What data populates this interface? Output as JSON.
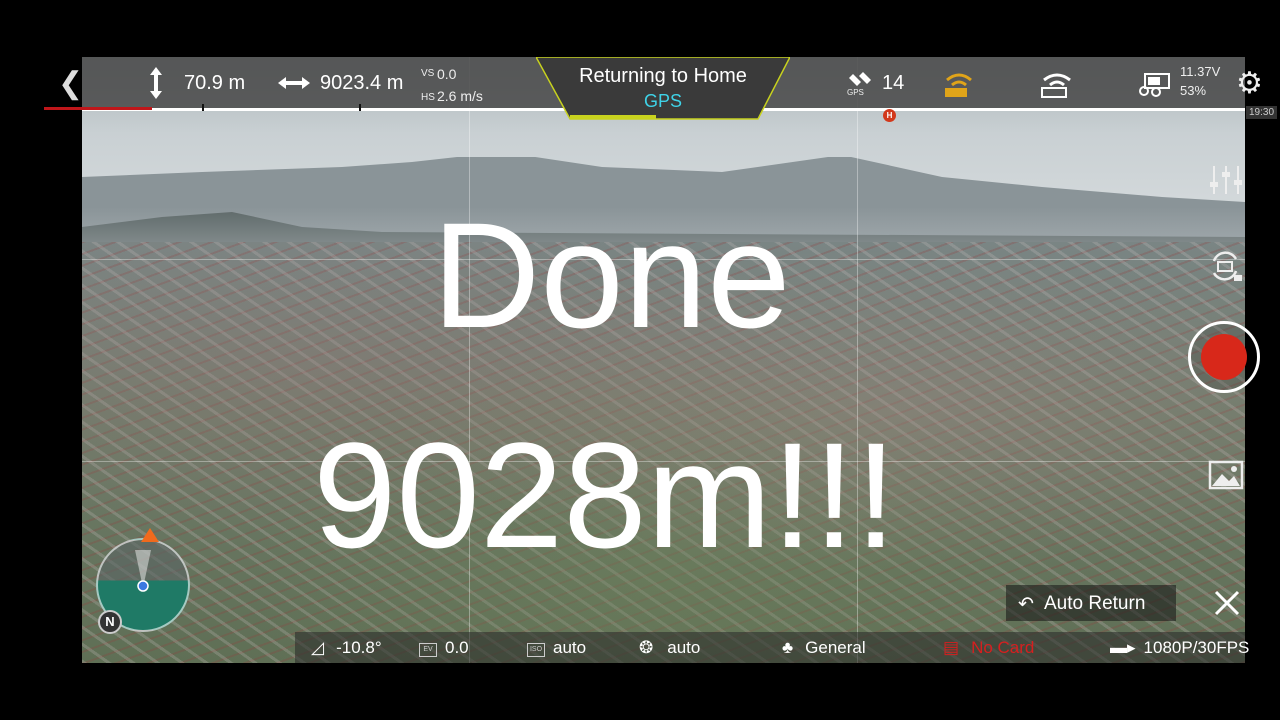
{
  "top_bar": {
    "altitude": "70.9 m",
    "distance": "9023.4 m",
    "vs_label": "VS",
    "vs_value": "0.0",
    "hs_label": "HS",
    "hs_value": "2.6 m/s",
    "status_title": "Returning to Home",
    "status_mode": "GPS",
    "gps_label": "GPS",
    "satellites": "14",
    "battery_voltage": "11.37V",
    "battery_percent": "53%",
    "home_marker": "H",
    "clock": "19:30"
  },
  "overlay": {
    "line1": "Done",
    "line2": "9028m!!!"
  },
  "right_controls": {
    "icons": [
      "sliders-icon",
      "camera-switch-icon",
      "record-button",
      "gallery-icon"
    ]
  },
  "compass": {
    "north_label": "N"
  },
  "auto_return": {
    "label": "Auto Return"
  },
  "bottom_bar": {
    "gimbal_pitch": "-10.8°",
    "ev_label": "EV",
    "ev_value": "0.0",
    "iso_label": "ISO",
    "iso_value": "auto",
    "shutter_value": "auto",
    "color_profile": "General",
    "sd_status": "No Card",
    "video_format": "1080P/30FPS"
  },
  "colors": {
    "record": "#d8281a",
    "gps_text": "#3fd3e8",
    "no_card": "#d61f1f",
    "rth_progress": "#c8d21e",
    "wifi_warning": "#e0a419"
  }
}
